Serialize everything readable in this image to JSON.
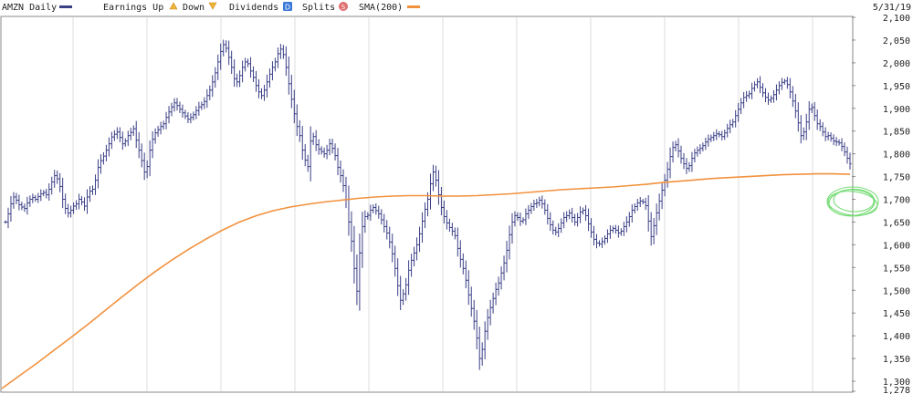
{
  "header": {
    "symbol_label": "AMZN Daily",
    "earnings_label": "Earnings Up",
    "down_label": "Down",
    "dividends_label": "Dividends",
    "dividends_icon_letter": "D",
    "splits_label": "Splits",
    "splits_icon_letter": "S",
    "sma_label": "SMA(200)",
    "date_label": "5/31/19"
  },
  "colors": {
    "price_bars": "#3a3f86",
    "sma": "#f2913d",
    "grid": "#dcdcdc",
    "earnings_up": "#f0b335",
    "down": "#f0b335",
    "dividends": "#3a78d8",
    "splits": "#e06e6e",
    "annotation": "#6ad96a"
  },
  "chart_data": {
    "type": "ohlc",
    "series": [
      {
        "name": "AMZN Daily",
        "values": [
          1650,
          1668,
          1690,
          1705,
          1698,
          1688,
          1683,
          1680,
          1692,
          1700,
          1704,
          1700,
          1706,
          1712,
          1715,
          1710,
          1722,
          1738,
          1752,
          1745,
          1728,
          1700,
          1680,
          1670,
          1676,
          1685,
          1690,
          1700,
          1694,
          1685,
          1705,
          1718,
          1722,
          1742,
          1770,
          1785,
          1795,
          1808,
          1822,
          1837,
          1843,
          1848,
          1836,
          1822,
          1828,
          1840,
          1847,
          1855,
          1830,
          1808,
          1785,
          1760,
          1772,
          1808,
          1832,
          1846,
          1853,
          1860,
          1866,
          1880,
          1892,
          1903,
          1912,
          1906,
          1898,
          1890,
          1883,
          1876,
          1880,
          1886,
          1895,
          1903,
          1908,
          1915,
          1928,
          1940,
          1958,
          1978,
          2002,
          2025,
          2040,
          2032,
          2012,
          1990,
          1965,
          1958,
          1972,
          1990,
          2002,
          1998,
          1982,
          1968,
          1950,
          1936,
          1928,
          1940,
          1958,
          1975,
          1990,
          2002,
          2020,
          2030,
          2018,
          1990,
          1954,
          1920,
          1888,
          1860,
          1840,
          1808,
          1786,
          1772,
          1828,
          1838,
          1820,
          1810,
          1805,
          1800,
          1808,
          1822,
          1812,
          1796,
          1770,
          1752,
          1730,
          1700,
          1650,
          1608,
          1548,
          1498,
          1582,
          1640,
          1662,
          1665,
          1676,
          1682,
          1675,
          1668,
          1655,
          1640,
          1626,
          1606,
          1580,
          1548,
          1510,
          1478,
          1492,
          1512,
          1544,
          1566,
          1582,
          1600,
          1624,
          1652,
          1678,
          1700,
          1734,
          1760,
          1742,
          1710,
          1682,
          1662,
          1648,
          1638,
          1630,
          1620,
          1592,
          1568,
          1548,
          1522,
          1490,
          1460,
          1432,
          1395,
          1350,
          1370,
          1410,
          1440,
          1462,
          1482,
          1502,
          1516,
          1538,
          1560,
          1588,
          1622,
          1650,
          1664,
          1660,
          1652,
          1655,
          1668,
          1676,
          1684,
          1690,
          1692,
          1698,
          1690,
          1676,
          1658,
          1644,
          1632,
          1628,
          1636,
          1648,
          1660,
          1664,
          1670,
          1660,
          1650,
          1660,
          1672,
          1676,
          1664,
          1646,
          1628,
          1612,
          1604,
          1602,
          1607,
          1614,
          1624,
          1632,
          1636,
          1632,
          1626,
          1630,
          1640,
          1650,
          1662,
          1676,
          1684,
          1692,
          1696,
          1694,
          1686,
          1652,
          1618,
          1642,
          1670,
          1696,
          1720,
          1742,
          1766,
          1794,
          1814,
          1820,
          1806,
          1790,
          1778,
          1768,
          1774,
          1790,
          1802,
          1808,
          1812,
          1818,
          1826,
          1832,
          1836,
          1840,
          1844,
          1842,
          1838,
          1846,
          1856,
          1864,
          1870,
          1884,
          1898,
          1912,
          1924,
          1928,
          1932,
          1944,
          1952,
          1958,
          1946,
          1934,
          1924,
          1918,
          1922,
          1930,
          1940,
          1950,
          1957,
          1960,
          1952,
          1936,
          1916,
          1894,
          1868,
          1840,
          1848,
          1870,
          1898,
          1902,
          1884,
          1866,
          1860,
          1848,
          1838,
          1840,
          1834,
          1828,
          1826,
          1824,
          1816,
          1804,
          1790,
          1778
        ]
      },
      {
        "name": "SMA(200)",
        "values": [
          1284,
          1311,
          1338,
          1366,
          1394,
          1423,
          1453,
          1483,
          1512,
          1540,
          1566,
          1590,
          1612,
          1632,
          1650,
          1664,
          1675,
          1683,
          1689,
          1694,
          1698,
          1702,
          1705,
          1707,
          1708,
          1708,
          1707,
          1707,
          1708,
          1710,
          1712,
          1715,
          1718,
          1721,
          1723,
          1725,
          1727,
          1730,
          1733,
          1737,
          1740,
          1743,
          1746,
          1748,
          1750,
          1752,
          1754,
          1755,
          1756,
          1756,
          1755
        ]
      }
    ],
    "y_ticks": [
      "2,100",
      "2,050",
      "2,000",
      "1,950",
      "1,900",
      "1,850",
      "1,800",
      "1,750",
      "1,700",
      "1,650",
      "1,600",
      "1,550",
      "1,500",
      "1,450",
      "1,400",
      "1,350",
      "1,300",
      "1,278"
    ],
    "ylim": [
      1278,
      2100
    ],
    "last_date": "5/31/19",
    "grid": true,
    "legend": "top"
  }
}
